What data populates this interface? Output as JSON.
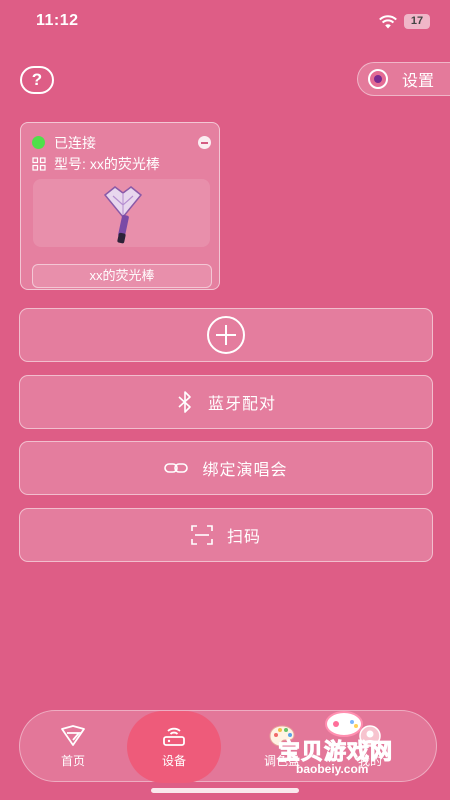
{
  "status_bar": {
    "time": "11:12",
    "battery": "17"
  },
  "header": {
    "help_label": "?",
    "settings_label": "设置"
  },
  "device_card": {
    "status": "已连接",
    "model_prefix": "型号:",
    "model_name": "xx的荧光棒",
    "device_name": "xx的荧光棒",
    "status_color": "#4fe04a"
  },
  "actions": {
    "bluetooth_label": "蓝牙配对",
    "bind_concert_label": "绑定演唱会",
    "scan_label": "扫码"
  },
  "tab_bar": {
    "tabs": [
      {
        "label": "首页",
        "icon": "logo-icon"
      },
      {
        "label": "设备",
        "icon": "router-icon",
        "active": true
      },
      {
        "label": "调色盘",
        "icon": "palette-icon"
      },
      {
        "label": "我的",
        "icon": "profile-icon"
      }
    ]
  },
  "watermark": {
    "text": "宝贝游戏网",
    "url": "baobeiy.com"
  },
  "colors": {
    "background": "#de5d86",
    "active_tab": "#ee5b7a",
    "accent": "#ffffff"
  }
}
